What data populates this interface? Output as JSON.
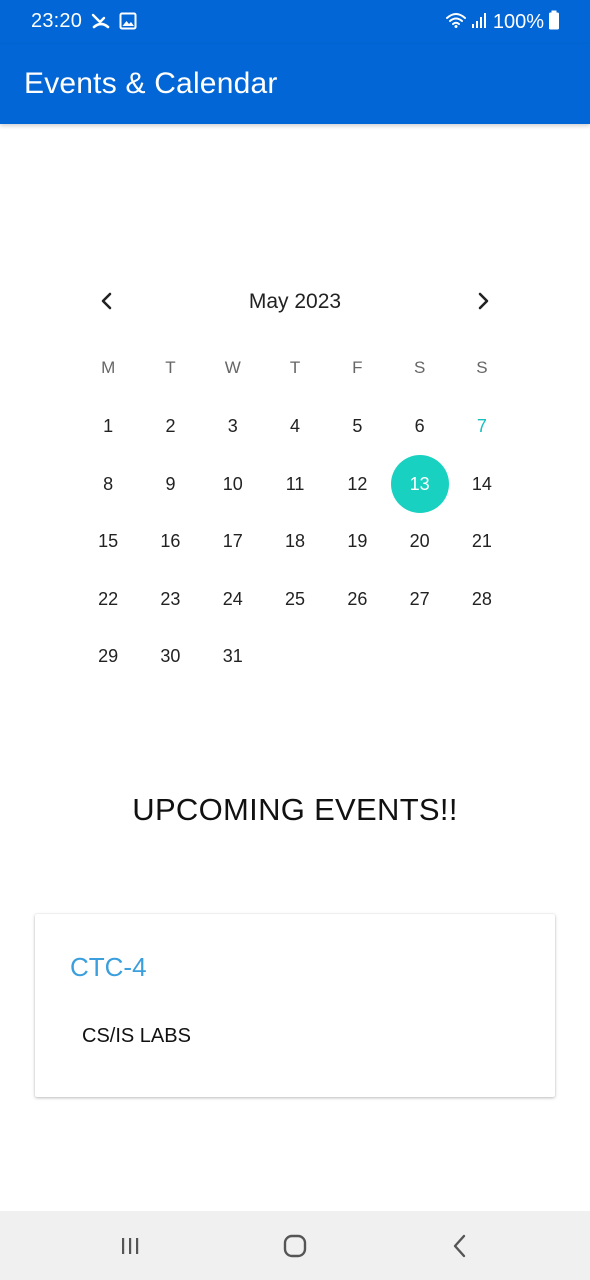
{
  "status_bar": {
    "time": "23:20",
    "battery": "100%",
    "left_icons": [
      "missed-call-icon",
      "image-icon"
    ],
    "right_icons": [
      "wifi-icon",
      "signal-icon",
      "battery-icon"
    ]
  },
  "app_bar": {
    "title": "Events & Calendar",
    "color": "#0366d6"
  },
  "calendar": {
    "month_label": "May 2023",
    "prev_icon": "chevron-left-icon",
    "next_icon": "chevron-right-icon",
    "weekdays": [
      "M",
      "T",
      "W",
      "T",
      "F",
      "S",
      "S"
    ],
    "weeks": [
      [
        "1",
        "2",
        "3",
        "4",
        "5",
        "6",
        "7"
      ],
      [
        "8",
        "9",
        "10",
        "11",
        "12",
        "13",
        "14"
      ],
      [
        "15",
        "16",
        "17",
        "18",
        "19",
        "20",
        "21"
      ],
      [
        "22",
        "23",
        "24",
        "25",
        "26",
        "27",
        "28"
      ],
      [
        "29",
        "30",
        "31",
        "",
        "",
        "",
        ""
      ]
    ],
    "today": "7",
    "selected": "13",
    "today_color": "#1abfbf",
    "selected_color": "#19d1c0"
  },
  "events": {
    "heading": "UPCOMING EVENTS!!",
    "items": [
      {
        "title": "CTC-4",
        "location": "CS/IS LABS"
      }
    ],
    "title_color": "#3a9fdc"
  },
  "nav_bar": {
    "icons": [
      "recents-icon",
      "home-icon",
      "back-icon"
    ]
  }
}
